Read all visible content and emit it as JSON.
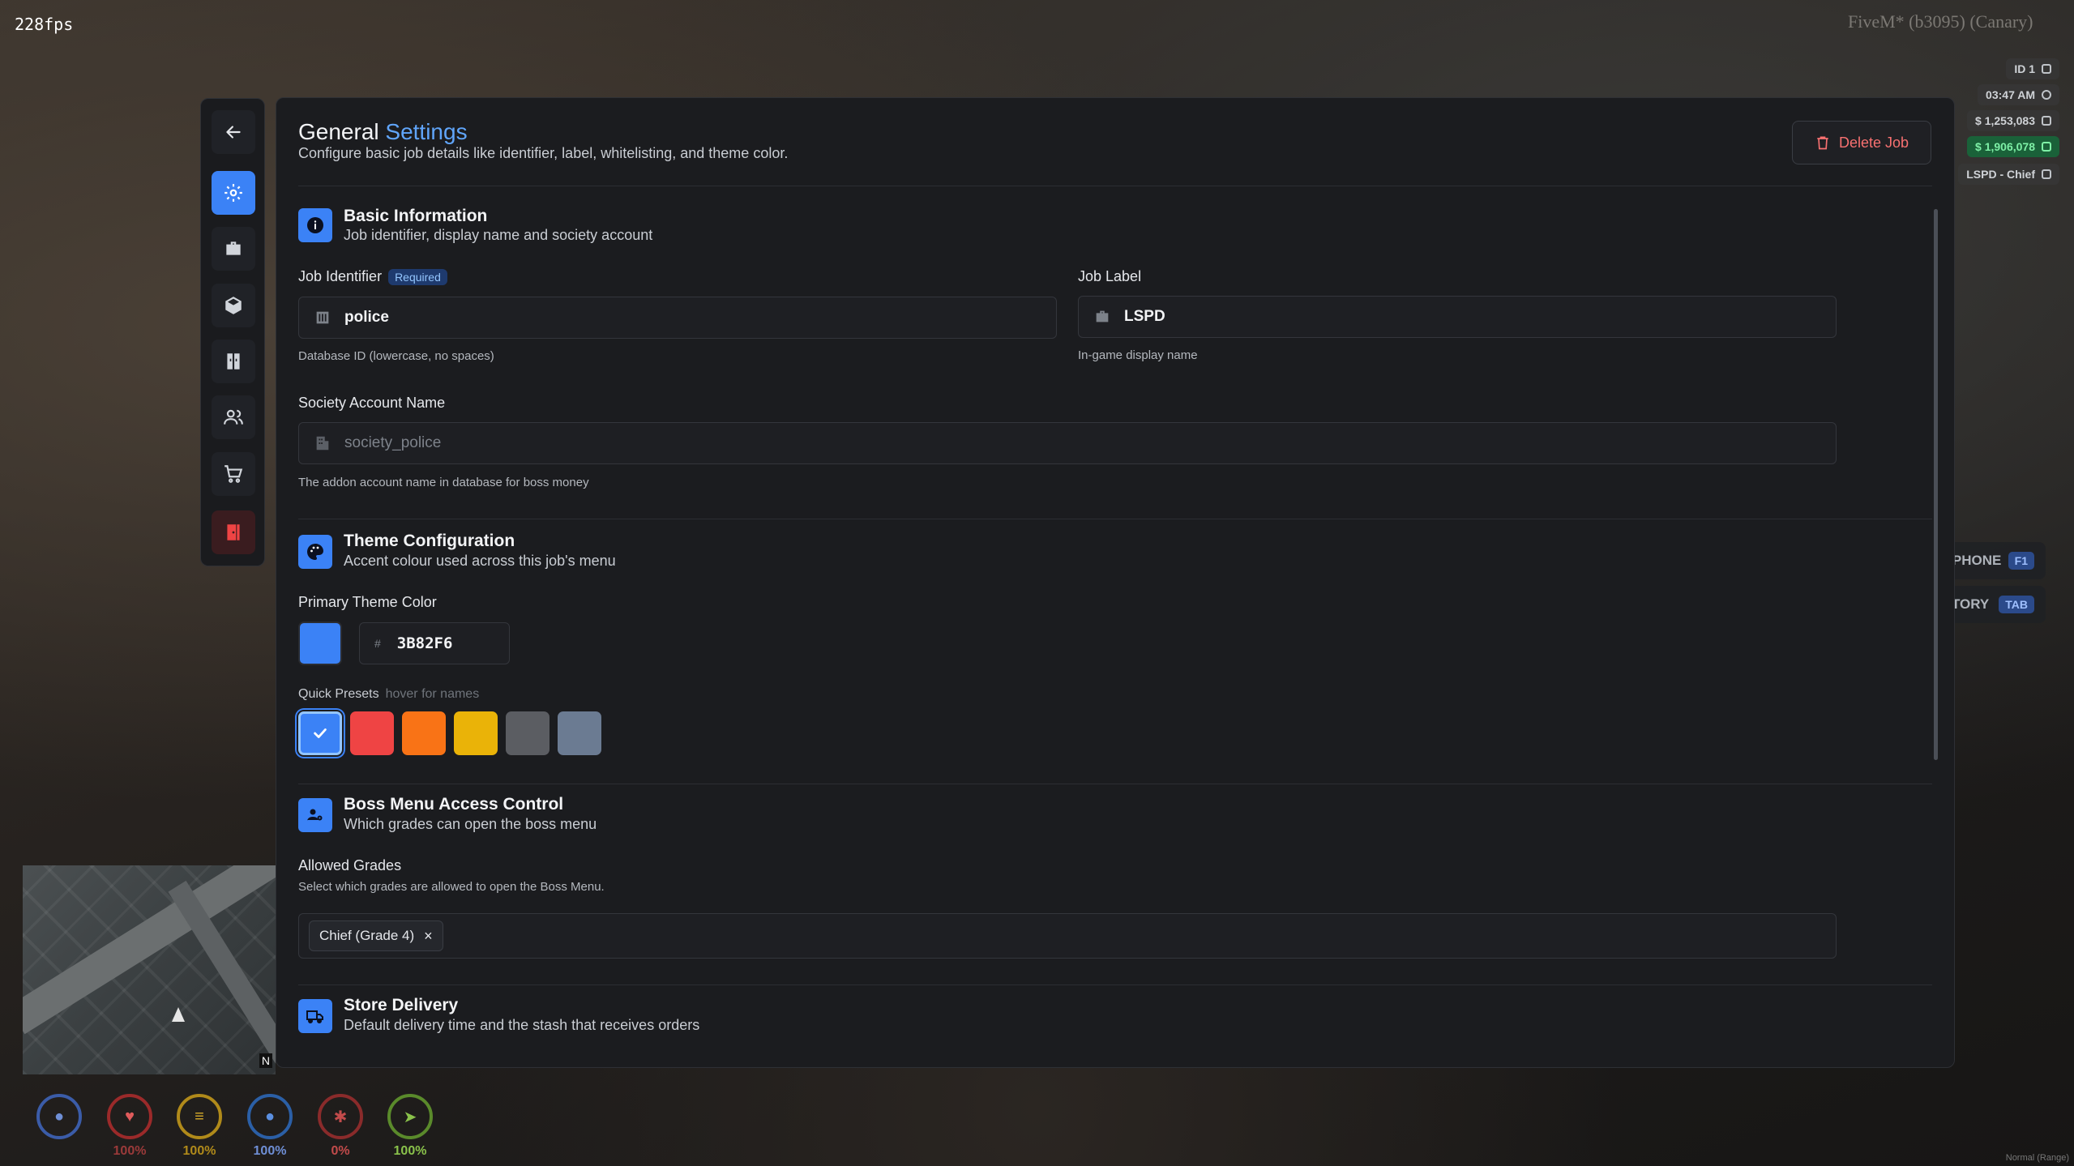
{
  "overlay": {
    "fps": "228fps",
    "build": "FiveM* (b3095) (Canary)",
    "id": "ID 1",
    "time": "03:47 AM",
    "cash": "$ 1,253,083",
    "bank": "$ 1,906,078",
    "job": "LSPD - Chief",
    "keybinds": [
      {
        "label": "OPEN PHONE",
        "key": "F1"
      },
      {
        "label": "INVENTORY",
        "key": "TAB"
      }
    ],
    "status": [
      {
        "name": "voice",
        "pct": "",
        "color": "#3b5ca8"
      },
      {
        "name": "health",
        "pct": "100%",
        "color": "#9b2a2a"
      },
      {
        "name": "hunger",
        "pct": "100%",
        "color": "#b08a1a"
      },
      {
        "name": "thirst",
        "pct": "100%",
        "color": "#2b5fa6"
      },
      {
        "name": "stress",
        "pct": "0%",
        "color": "#8a2b2b"
      },
      {
        "name": "stamina",
        "pct": "100%",
        "color": "#5a8a2b"
      }
    ],
    "minimap_north": "N",
    "corner_note": "Normal (Range)"
  },
  "header": {
    "title_part1": "General",
    "title_part2": "Settings",
    "subtitle": "Configure basic job details like identifier, label, whitelisting, and theme color.",
    "delete_label": "Delete Job"
  },
  "basic": {
    "title": "Basic Information",
    "desc": "Job identifier, display name and society account",
    "identifier_label": "Job Identifier",
    "required": "Required",
    "identifier_value": "police",
    "identifier_hint": "Database ID (lowercase, no spaces)",
    "label_label": "Job Label",
    "label_value": "LSPD",
    "label_hint": "In-game display name",
    "society_label": "Society Account Name",
    "society_placeholder": "society_police",
    "society_hint": "The addon account name in database for boss money"
  },
  "theme": {
    "title": "Theme Configuration",
    "desc": "Accent colour used across this job's menu",
    "primary_label": "Primary Theme Color",
    "hash": "#",
    "hex_value": "3B82F6",
    "primary_color": "#3b82f6",
    "presets_label": "Quick Presets",
    "presets_hint": "hover for names",
    "presets": [
      "#3b82f6",
      "#ef4444",
      "#f97316",
      "#eab308",
      "#5b5d62",
      "#6b7b92"
    ]
  },
  "boss": {
    "title": "Boss Menu Access Control",
    "desc": "Which grades can open the boss menu",
    "allowed_label": "Allowed Grades",
    "allowed_hint": "Select which grades are allowed to open the Boss Menu.",
    "tags": [
      "Chief (Grade 4)"
    ],
    "tag_remove": "×"
  },
  "store": {
    "title": "Store Delivery",
    "desc": "Default delivery time and the stash that receives orders"
  }
}
